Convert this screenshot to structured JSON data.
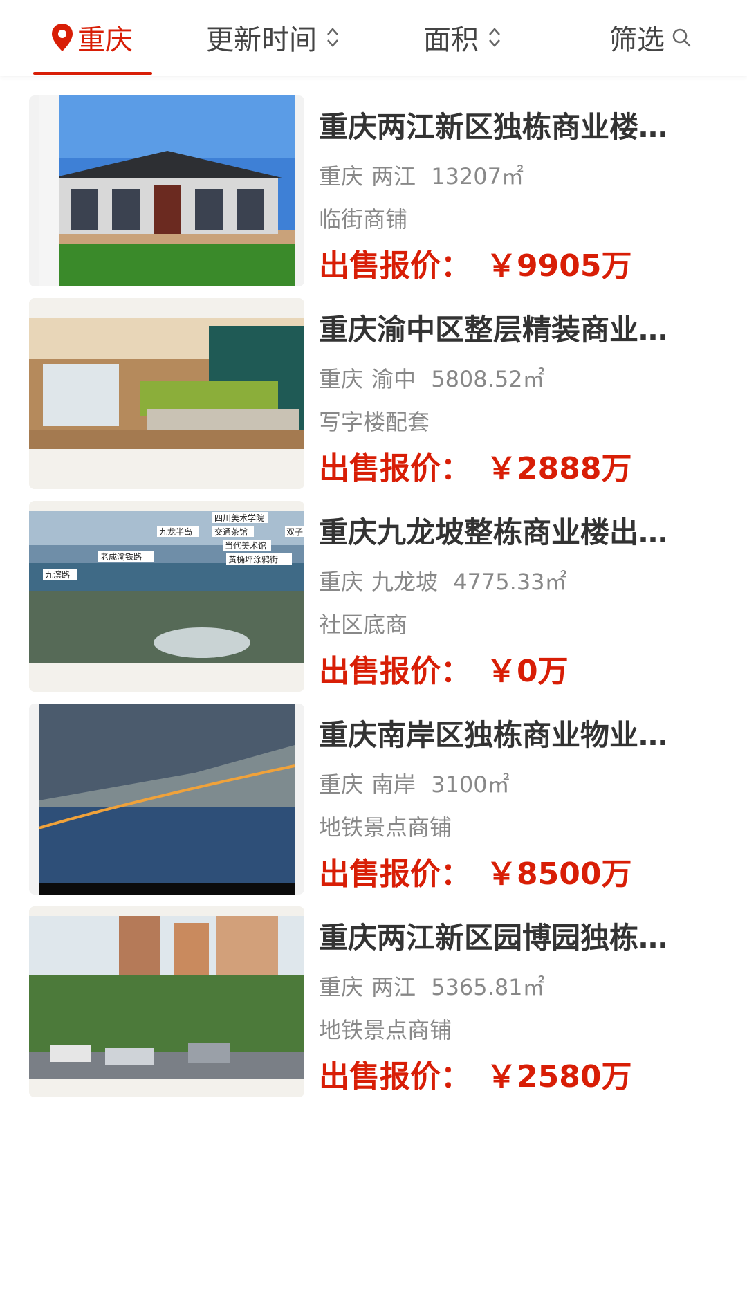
{
  "filters": {
    "city": "重庆",
    "sort_time": "更新时间",
    "sort_area": "面积",
    "filter": "筛选"
  },
  "price_label": "出售报价：",
  "listings": [
    {
      "title": "重庆两江新区独栋商业楼…",
      "city": "重庆",
      "district": "两江",
      "area": "13207㎡",
      "tag": "临街商铺",
      "price": "￥9905万"
    },
    {
      "title": "重庆渝中区整层精装商业…",
      "city": "重庆",
      "district": "渝中",
      "area": "5808.52㎡",
      "tag": "写字楼配套",
      "price": "￥2888万"
    },
    {
      "title": "重庆九龙坡整栋商业楼出…",
      "city": "重庆",
      "district": "九龙坡",
      "area": "4775.33㎡",
      "tag": "社区底商",
      "price": "￥0万"
    },
    {
      "title": "重庆南岸区独栋商业物业…",
      "city": "重庆",
      "district": "南岸",
      "area": "3100㎡",
      "tag": "地铁景点商铺",
      "price": "￥8500万"
    },
    {
      "title": "重庆两江新区园博园独栋…",
      "city": "重庆",
      "district": "两江",
      "area": "5365.81㎡",
      "tag": "地铁景点商铺",
      "price": "￥2580万"
    }
  ],
  "map_labels": [
    "四川美术学院",
    "九龙半岛",
    "交通茶馆",
    "双子",
    "当代美术馆",
    "老成渝铁路",
    "黄桷坪涂鸦街",
    "九滨路"
  ],
  "colors": {
    "accent": "#d81e06",
    "title": "#333333",
    "meta": "#888888"
  }
}
